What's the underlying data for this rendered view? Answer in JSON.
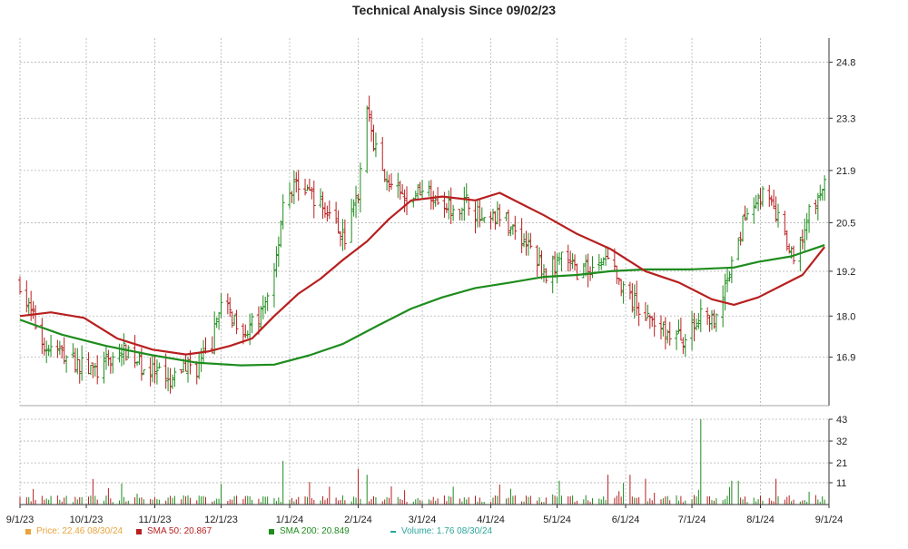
{
  "chart_data": {
    "type": "ohlc",
    "title": "Technical Analysis Since 09/02/23",
    "price_axis": {
      "ticks": [
        16.9,
        18.0,
        19.2,
        20.5,
        21.9,
        23.3,
        24.8
      ],
      "range": [
        15.6,
        25.3
      ]
    },
    "volume_axis": {
      "ticks": [
        11,
        21,
        32,
        43
      ],
      "range": [
        0,
        43
      ]
    },
    "x_axis": {
      "start_date": "2023-09-01",
      "end_date": "2024-09-01",
      "ticks": [
        {
          "date": "2023-09-01",
          "label": "9/1/23"
        },
        {
          "date": "2023-10-01",
          "label": "10/1/23"
        },
        {
          "date": "2023-11-01",
          "label": "11/1/23"
        },
        {
          "date": "2023-12-01",
          "label": "12/1/23"
        },
        {
          "date": "2024-01-01",
          "label": "1/1/24"
        },
        {
          "date": "2024-02-01",
          "label": "2/1/24"
        },
        {
          "date": "2024-03-01",
          "label": "3/1/24"
        },
        {
          "date": "2024-04-01",
          "label": "4/1/24"
        },
        {
          "date": "2024-05-01",
          "label": "5/1/24"
        },
        {
          "date": "2024-06-01",
          "label": "6/1/24"
        },
        {
          "date": "2024-07-01",
          "label": "7/1/24"
        },
        {
          "date": "2024-08-01",
          "label": "8/1/24"
        },
        {
          "date": "2024-09-01",
          "label": "9/1/24"
        }
      ]
    },
    "price_path": [
      [
        "2023-09-01",
        18.9
      ],
      [
        "2023-09-05",
        18.2
      ],
      [
        "2023-09-12",
        17.2
      ],
      [
        "2023-09-20",
        17.0
      ],
      [
        "2023-09-28",
        16.7
      ],
      [
        "2023-10-06",
        16.5
      ],
      [
        "2023-10-13",
        16.9
      ],
      [
        "2023-10-20",
        17.1
      ],
      [
        "2023-10-27",
        16.6
      ],
      [
        "2023-11-03",
        16.4
      ],
      [
        "2023-11-08",
        16.1
      ],
      [
        "2023-11-14",
        16.7
      ],
      [
        "2023-11-20",
        16.6
      ],
      [
        "2023-11-27",
        17.2
      ],
      [
        "2023-11-30",
        18.3
      ],
      [
        "2023-12-06",
        18.0
      ],
      [
        "2023-12-13",
        17.6
      ],
      [
        "2023-12-20",
        18.1
      ],
      [
        "2023-12-26",
        19.6
      ],
      [
        "2023-12-29",
        21.1
      ],
      [
        "2024-01-05",
        21.6
      ],
      [
        "2024-01-12",
        21.2
      ],
      [
        "2024-01-19",
        20.7
      ],
      [
        "2024-01-26",
        20.1
      ],
      [
        "2024-02-01",
        21.3
      ],
      [
        "2024-02-05",
        23.5
      ],
      [
        "2024-02-09",
        22.4
      ],
      [
        "2024-02-16",
        21.5
      ],
      [
        "2024-02-23",
        21.0
      ],
      [
        "2024-03-01",
        21.5
      ],
      [
        "2024-03-08",
        21.2
      ],
      [
        "2024-03-15",
        20.9
      ],
      [
        "2024-03-22",
        21.1
      ],
      [
        "2024-03-29",
        20.4
      ],
      [
        "2024-04-05",
        20.7
      ],
      [
        "2024-04-12",
        20.3
      ],
      [
        "2024-04-19",
        19.8
      ],
      [
        "2024-04-26",
        19.1
      ],
      [
        "2024-05-03",
        19.6
      ],
      [
        "2024-05-10",
        19.2
      ],
      [
        "2024-05-17",
        19.3
      ],
      [
        "2024-05-24",
        19.6
      ],
      [
        "2024-05-31",
        18.6
      ],
      [
        "2024-06-07",
        18.2
      ],
      [
        "2024-06-14",
        17.8
      ],
      [
        "2024-06-21",
        17.5
      ],
      [
        "2024-06-28",
        17.4
      ],
      [
        "2024-07-05",
        18.0
      ],
      [
        "2024-07-12",
        17.8
      ],
      [
        "2024-07-19",
        19.3
      ],
      [
        "2024-07-26",
        20.9
      ],
      [
        "2024-08-02",
        21.3
      ],
      [
        "2024-08-09",
        20.6
      ],
      [
        "2024-08-16",
        19.4
      ],
      [
        "2024-08-23",
        20.7
      ],
      [
        "2024-08-30",
        21.5
      ]
    ],
    "sma50": [
      [
        "2023-09-01",
        18.0
      ],
      [
        "2023-09-15",
        18.1
      ],
      [
        "2023-09-30",
        17.95
      ],
      [
        "2023-10-15",
        17.4
      ],
      [
        "2023-10-31",
        17.1
      ],
      [
        "2023-11-15",
        16.97
      ],
      [
        "2023-11-25",
        17.05
      ],
      [
        "2023-12-05",
        17.2
      ],
      [
        "2023-12-15",
        17.4
      ],
      [
        "2023-12-25",
        18.0
      ],
      [
        "2024-01-05",
        18.6
      ],
      [
        "2024-01-15",
        19.0
      ],
      [
        "2024-01-25",
        19.5
      ],
      [
        "2024-02-05",
        20.0
      ],
      [
        "2024-02-15",
        20.6
      ],
      [
        "2024-02-25",
        21.1
      ],
      [
        "2024-03-10",
        21.2
      ],
      [
        "2024-03-25",
        21.1
      ],
      [
        "2024-04-05",
        21.3
      ],
      [
        "2024-04-15",
        21.0
      ],
      [
        "2024-04-25",
        20.7
      ],
      [
        "2024-05-10",
        20.2
      ],
      [
        "2024-05-25",
        19.8
      ],
      [
        "2024-06-10",
        19.2
      ],
      [
        "2024-06-25",
        18.9
      ],
      [
        "2024-07-10",
        18.45
      ],
      [
        "2024-07-20",
        18.3
      ],
      [
        "2024-07-31",
        18.5
      ],
      [
        "2024-08-10",
        18.8
      ],
      [
        "2024-08-20",
        19.1
      ],
      [
        "2024-08-30",
        19.85
      ]
    ],
    "sma200": [
      [
        "2023-09-01",
        17.9
      ],
      [
        "2023-09-20",
        17.5
      ],
      [
        "2023-10-10",
        17.2
      ],
      [
        "2023-10-31",
        16.95
      ],
      [
        "2023-11-20",
        16.75
      ],
      [
        "2023-12-10",
        16.68
      ],
      [
        "2023-12-25",
        16.7
      ],
      [
        "2024-01-10",
        16.95
      ],
      [
        "2024-01-25",
        17.25
      ],
      [
        "2024-02-10",
        17.75
      ],
      [
        "2024-02-25",
        18.2
      ],
      [
        "2024-03-10",
        18.5
      ],
      [
        "2024-03-25",
        18.75
      ],
      [
        "2024-04-10",
        18.9
      ],
      [
        "2024-04-25",
        19.05
      ],
      [
        "2024-05-10",
        19.1
      ],
      [
        "2024-05-25",
        19.2
      ],
      [
        "2024-06-10",
        19.25
      ],
      [
        "2024-06-30",
        19.25
      ],
      [
        "2024-07-20",
        19.3
      ],
      [
        "2024-07-31",
        19.45
      ],
      [
        "2024-08-15",
        19.6
      ],
      [
        "2024-08-30",
        19.9
      ]
    ],
    "volume": {
      "typical": 3,
      "spikes": [
        [
          "2023-12-29",
          22
        ],
        [
          "2024-02-01",
          18
        ],
        [
          "2024-02-05",
          15
        ],
        [
          "2024-05-24",
          15
        ],
        [
          "2024-06-03",
          15
        ],
        [
          "2024-06-10",
          13
        ],
        [
          "2024-07-05",
          43
        ],
        [
          "2024-07-19",
          12
        ],
        [
          "2024-01-19",
          9
        ],
        [
          "2024-03-15",
          9
        ],
        [
          "2024-05-02",
          12
        ]
      ]
    },
    "legend": [
      {
        "key": "price",
        "label": "Price: 22.46  08/30/24",
        "color": "#e8a33a",
        "shape": "square"
      },
      {
        "key": "sma50",
        "label": "SMA 50: 20.867",
        "color": "#b81f1f",
        "shape": "square"
      },
      {
        "key": "sma200",
        "label": "SMA 200: 20.849",
        "color": "#1e8c1e",
        "shape": "square"
      },
      {
        "key": "volume",
        "label": "Volume: 1.76  08/30/24",
        "color": "#2aa59a",
        "shape": "line"
      }
    ],
    "colors": {
      "up": "#1e8c1e",
      "down": "#b81f1f",
      "sma50": "#b81f1f",
      "sma200": "#1e8c1e",
      "volume_up": "#1e8c1e",
      "volume_down": "#b81f1f",
      "grid": "#b4b4b4"
    },
    "grid": true
  }
}
